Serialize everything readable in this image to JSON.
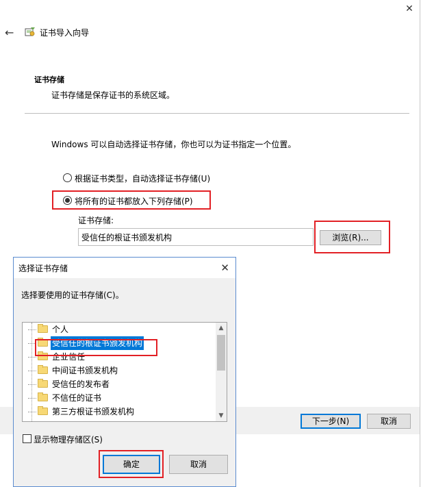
{
  "wizard": {
    "title": "证书导入向导",
    "section_title": "证书存储",
    "section_desc": "证书存储是保存证书的系统区域。",
    "info": "Windows 可以自动选择证书存储，你也可以为证书指定一个位置。",
    "radio_auto": "根据证书类型，自动选择证书存储(U)",
    "radio_manual": "将所有的证书都放入下列存储(P)",
    "store_label": "证书存储:",
    "store_value": "受信任的根证书颁发机构",
    "browse_button": "浏览(R)...",
    "next_button": "下一步(N)",
    "cancel_button": "取消"
  },
  "dialog": {
    "title": "选择证书存储",
    "prompt": "选择要使用的证书存储(C)。",
    "items": [
      "个人",
      "受信任的根证书颁发机构",
      "企业信任",
      "中间证书颁发机构",
      "受信任的发布者",
      "不信任的证书",
      "第三方根证书颁发机构"
    ],
    "selected_index": 1,
    "show_physical": "显示物理存储区(S)",
    "ok_button": "确定",
    "cancel_button": "取消"
  },
  "colors": {
    "accent": "#0078d7",
    "highlight_box": "#e21f24",
    "folder": "#f7d875"
  }
}
